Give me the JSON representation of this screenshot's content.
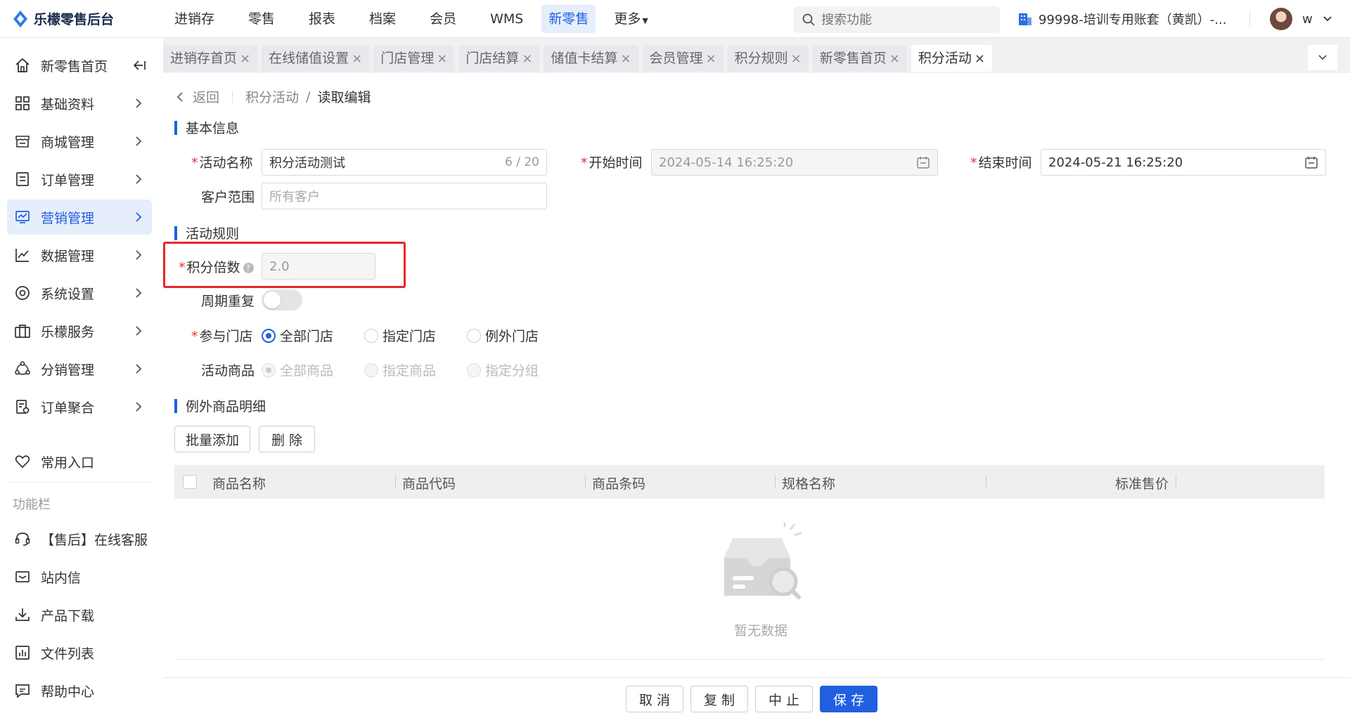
{
  "app": {
    "title": "乐檬零售后台"
  },
  "topnav": [
    {
      "label": "进销存",
      "active": false
    },
    {
      "label": "零售",
      "active": false
    },
    {
      "label": "报表",
      "active": false
    },
    {
      "label": "档案",
      "active": false
    },
    {
      "label": "会员",
      "active": false
    },
    {
      "label": "WMS",
      "active": false
    },
    {
      "label": "新零售",
      "active": true
    },
    {
      "label": "更多",
      "active": false
    }
  ],
  "search": {
    "placeholder": "搜索功能"
  },
  "account": {
    "label": "99998-培训专用账套（黄凯）-..."
  },
  "user": {
    "name": "w"
  },
  "sidebar": {
    "items": [
      {
        "label": "新零售首页",
        "icon": "home-icon"
      },
      {
        "label": "基础资料",
        "icon": "grid-icon"
      },
      {
        "label": "商城管理",
        "icon": "store-icon"
      },
      {
        "label": "订单管理",
        "icon": "order-icon"
      },
      {
        "label": "营销管理",
        "icon": "marketing-icon",
        "active": true
      },
      {
        "label": "数据管理",
        "icon": "chart-icon"
      },
      {
        "label": "系统设置",
        "icon": "settings-icon"
      },
      {
        "label": "乐檬服务",
        "icon": "briefcase-icon"
      },
      {
        "label": "分销管理",
        "icon": "share-icon"
      },
      {
        "label": "订单聚合",
        "icon": "aggregate-icon"
      }
    ],
    "favorites": "常用入口",
    "group_title": "功能栏",
    "tools": [
      {
        "label": "【售后】在线客服",
        "icon": "headset-icon"
      },
      {
        "label": "站内信",
        "icon": "mail-icon"
      },
      {
        "label": "产品下载",
        "icon": "download-icon"
      },
      {
        "label": "文件列表",
        "icon": "file-list-icon"
      },
      {
        "label": "帮助中心",
        "icon": "help-chat-icon"
      }
    ]
  },
  "tabs": [
    {
      "label": "进销存首页"
    },
    {
      "label": "在线储值设置"
    },
    {
      "label": "门店管理"
    },
    {
      "label": "门店结算"
    },
    {
      "label": "储值卡结算"
    },
    {
      "label": "会员管理"
    },
    {
      "label": "积分规则"
    },
    {
      "label": "新零售首页"
    },
    {
      "label": "积分活动",
      "active": true
    }
  ],
  "breadcrumb": {
    "back": "返回",
    "parent": "积分活动",
    "sep": "/",
    "current": "读取编辑"
  },
  "basic": {
    "title": "基本信息",
    "name_label": "活动名称",
    "name_value": "积分活动测试",
    "name_count": "6 / 20",
    "start_label": "开始时间",
    "start_value": "2024-05-14 16:25:20",
    "end_label": "结束时间",
    "end_value": "2024-05-21 16:25:20",
    "customer_label": "客户范围",
    "customer_placeholder": "所有客户"
  },
  "rules": {
    "title": "活动规则",
    "multiplier_label": "积分倍数",
    "multiplier_value": "2.0",
    "repeat_label": "周期重复",
    "repeat_on": false,
    "stores_label": "参与门店",
    "stores_options": [
      "全部门店",
      "指定门店",
      "例外门店"
    ],
    "stores_selected": "全部门店",
    "goods_label": "活动商品",
    "goods_options": [
      "全部商品",
      "指定商品",
      "指定分组"
    ],
    "goods_selected": "全部商品"
  },
  "exceptions": {
    "title": "例外商品明细",
    "batch_add": "批量添加",
    "delete": "删 除",
    "columns": [
      "商品名称",
      "商品代码",
      "商品条码",
      "规格名称",
      "标准售价"
    ],
    "empty_text": "暂无数据"
  },
  "footer": {
    "cancel": "取 消",
    "copy": "复 制",
    "stop": "中 止",
    "save": "保 存"
  },
  "colors": {
    "primary": "#1f5fe0",
    "required": "#e33333",
    "highlight": "#e8262a"
  }
}
